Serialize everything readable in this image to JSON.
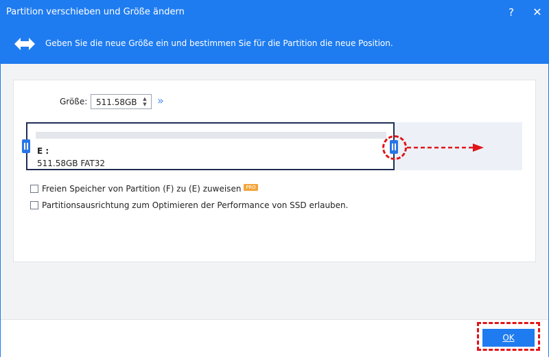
{
  "window": {
    "title": "Partition verschieben und Größe ändern",
    "help_label": "?",
    "close_label": "✕"
  },
  "banner": {
    "text": "Geben Sie die neue Größe ein und bestimmen Sie für die Partition die neue Position.",
    "icon": "resize-arrows-icon"
  },
  "size": {
    "label": "Größe:",
    "value": "511.58GB",
    "up": "▲",
    "down": "▼",
    "expand_icon": "»"
  },
  "partition": {
    "letter": "E :",
    "info": "511.58GB FAT32",
    "usage_fraction": 0
  },
  "options": [
    {
      "label": "Freien Speicher von Partition (F) zu (E) zuweisen",
      "checked": false,
      "badge": "PRO"
    },
    {
      "label": "Partitionsausrichtung zum Optimieren der Performance von SSD erlauben.",
      "checked": false
    }
  ],
  "footer": {
    "ok_label": "OK"
  },
  "colors": {
    "accent": "#1f7cf0",
    "annotation": "#e0151a",
    "pro_badge": "#f3a43a",
    "partition_border": "#1e2e55"
  }
}
